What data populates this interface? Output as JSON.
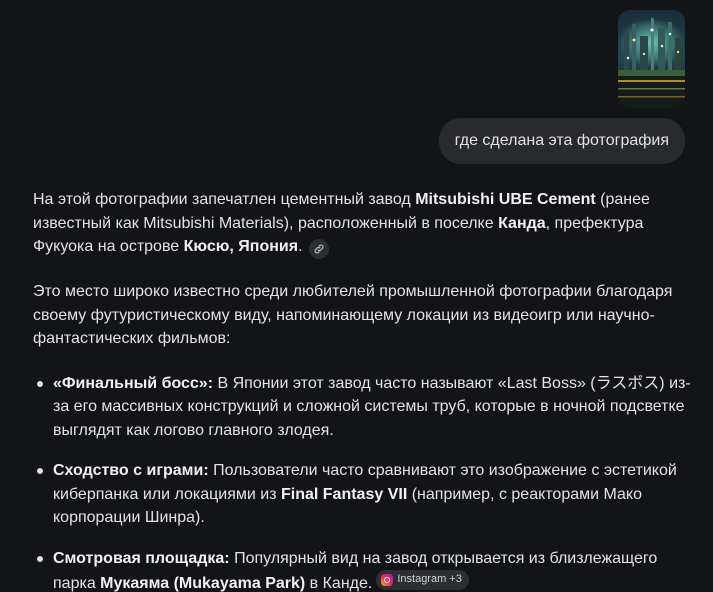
{
  "user_message": {
    "text": "где сделана эта фотография"
  },
  "response": {
    "p1": {
      "t1": "На этой фотографии запечатлен цементный завод ",
      "b1": "Mitsubishi UBE Cement",
      "t2": " (ранее известный как Mitsubishi Materials), расположенный в поселке ",
      "b2": "Канда",
      "t3": ", префектура Фукуока на острове ",
      "b3": "Кюсю, Япония",
      "t4": "."
    },
    "p2": {
      "text": "Это место широко известно среди любителей промышленной фотографии благодаря своему футуристическому виду, напоминающему локации из видеоигр или научно-фантастических фильмов:"
    },
    "bullets": [
      {
        "label": "«Финальный босс»:",
        "t1": " В Японии этот завод часто называют «Last Boss» (ラスボス) из-за его массивных конструкций и сложной системы труб, которые в ночной подсветке выглядят как логово главного злодея."
      },
      {
        "label": "Сходство с играми:",
        "t1": " Пользователи часто сравнивают это изображение с эстетикой киберпанка или локациями из ",
        "b1": "Final Fantasy VII",
        "t2": " (например, с реакторами Мако корпорации Шинра)."
      },
      {
        "label": "Смотровая площадка:",
        "t1": " Популярный вид на завод открывается из близлежащего парка ",
        "b1": "Мукаяма (Mukayama Park)",
        "t2": " в Канде."
      }
    ],
    "source_chip": {
      "label": "Instagram +3",
      "icon": "instagram-icon"
    },
    "link_chip": {
      "icon": "link-icon"
    }
  },
  "colors": {
    "background": "#131417",
    "bubble": "#282a2e",
    "text": "#e3e3e3",
    "chip": "#2c2e33"
  }
}
